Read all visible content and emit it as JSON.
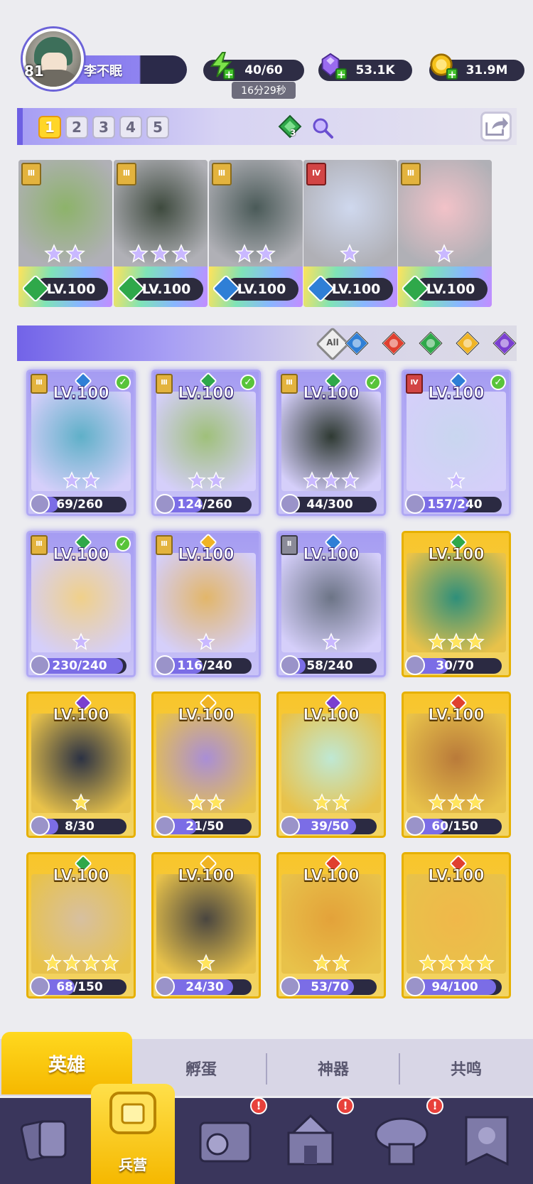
{
  "player": {
    "level": "81",
    "name": "李不眠"
  },
  "resources": {
    "energy": "40/60",
    "energy_timer": "16分29秒",
    "gems": "53.1K",
    "coins": "31.9M"
  },
  "team": {
    "slots": [
      "1",
      "2",
      "3",
      "4",
      "5"
    ],
    "active_slot": "1",
    "gem_count": "3",
    "members": [
      {
        "rank": "III",
        "level": "LV.100",
        "element": "nature",
        "stars": 2,
        "art": "#8db36a"
      },
      {
        "rank": "III",
        "level": "LV.100",
        "element": "nature",
        "stars": 3,
        "art": "#3e4a3e"
      },
      {
        "rank": "III",
        "level": "LV.100",
        "element": "water",
        "stars": 2,
        "art": "#4a5a58"
      },
      {
        "rank": "IV",
        "level": "LV.100",
        "element": "water",
        "stars": 1,
        "art": "#cfd8ee"
      },
      {
        "rank": "III",
        "level": "LV.100",
        "element": "nature",
        "stars": 1,
        "art": "#f2c2c8"
      }
    ]
  },
  "filters": {
    "all_label": "All",
    "elements": [
      "water",
      "fire",
      "nature",
      "light",
      "dark"
    ]
  },
  "heroes": [
    {
      "rank": "III",
      "element": "water",
      "level": "LV.100",
      "stars": 2,
      "progress": "69/260",
      "ratio": 0.27,
      "owned": true,
      "frame": "purple",
      "art": "#5fb0c8"
    },
    {
      "rank": "III",
      "element": "nature",
      "level": "LV.100",
      "stars": 2,
      "progress": "124/260",
      "ratio": 0.48,
      "owned": true,
      "frame": "purple",
      "art": "#9fc07a"
    },
    {
      "rank": "III",
      "element": "nature",
      "level": "LV.100",
      "stars": 3,
      "progress": "44/300",
      "ratio": 0.15,
      "owned": true,
      "frame": "purple",
      "art": "#2f3a33"
    },
    {
      "rank": "IV",
      "element": "water",
      "level": "LV.100",
      "stars": 1,
      "progress": "157/240",
      "ratio": 0.65,
      "owned": true,
      "frame": "purple",
      "art": "#c9d6ef"
    },
    {
      "rank": "III",
      "element": "nature",
      "level": "LV.100",
      "stars": 1,
      "progress": "230/240",
      "ratio": 0.96,
      "owned": true,
      "frame": "purple",
      "art": "#f0d08a"
    },
    {
      "rank": "III",
      "element": "light",
      "level": "LV.100",
      "stars": 1,
      "progress": "116/240",
      "ratio": 0.48,
      "owned": false,
      "frame": "purple",
      "art": "#e2b66a"
    },
    {
      "rank": "II",
      "element": "water",
      "level": "LV.100",
      "stars": 1,
      "progress": "58/240",
      "ratio": 0.24,
      "owned": false,
      "frame": "purple",
      "art": "#6c7486"
    },
    {
      "rank": "",
      "element": "nature",
      "level": "LV.100",
      "stars": 3,
      "progress": "30/70",
      "ratio": 0.43,
      "owned": false,
      "frame": "gold",
      "art": "#2f8f7a"
    },
    {
      "rank": "",
      "element": "dark",
      "level": "LV.100",
      "stars": 1,
      "progress": "8/30",
      "ratio": 0.27,
      "owned": false,
      "frame": "gold",
      "art": "#2c3244"
    },
    {
      "rank": "",
      "element": "light",
      "level": "LV.100",
      "stars": 2,
      "progress": "21/50",
      "ratio": 0.42,
      "owned": false,
      "frame": "gold",
      "art": "#a98ed6"
    },
    {
      "rank": "",
      "element": "dark",
      "level": "LV.100",
      "stars": 2,
      "progress": "39/50",
      "ratio": 0.78,
      "owned": false,
      "frame": "gold",
      "art": "#bfe8d4"
    },
    {
      "rank": "",
      "element": "fire",
      "level": "LV.100",
      "stars": 3,
      "progress": "60/150",
      "ratio": 0.4,
      "owned": false,
      "frame": "gold",
      "art": "#b97a3a"
    },
    {
      "rank": "",
      "element": "nature",
      "level": "LV.100",
      "stars": 4,
      "progress": "68/150",
      "ratio": 0.45,
      "owned": false,
      "frame": "gold",
      "art": "#d7c0a0"
    },
    {
      "rank": "",
      "element": "light",
      "level": "LV.100",
      "stars": 1,
      "progress": "24/30",
      "ratio": 0.8,
      "owned": false,
      "frame": "gold",
      "art": "#4a4640"
    },
    {
      "rank": "",
      "element": "fire",
      "level": "LV.100",
      "stars": 2,
      "progress": "53/70",
      "ratio": 0.76,
      "owned": false,
      "frame": "gold",
      "art": "#e3a23a"
    },
    {
      "rank": "",
      "element": "fire",
      "level": "LV.100",
      "stars": 4,
      "progress": "94/100",
      "ratio": 0.94,
      "owned": false,
      "frame": "gold",
      "art": "#f0b84a"
    }
  ],
  "tabs": {
    "hero": "英雄",
    "hatch": "孵蛋",
    "artifact": "神器",
    "resonance": "共鸣"
  },
  "nav": {
    "active_label": "兵营",
    "items": [
      {
        "icon": "cards-icon",
        "alert": false
      },
      {
        "icon": "barracks-icon",
        "alert": false
      },
      {
        "icon": "book-map-icon",
        "alert": true
      },
      {
        "icon": "castle-icon",
        "alert": true
      },
      {
        "icon": "mushroom-house-icon",
        "alert": true
      },
      {
        "icon": "guild-banner-icon",
        "alert": false
      }
    ]
  },
  "colors": {
    "water": "#2f7fd6",
    "fire": "#e0402f",
    "nature": "#2fa84a",
    "light": "#f0b424",
    "dark": "#7a3fd0"
  }
}
